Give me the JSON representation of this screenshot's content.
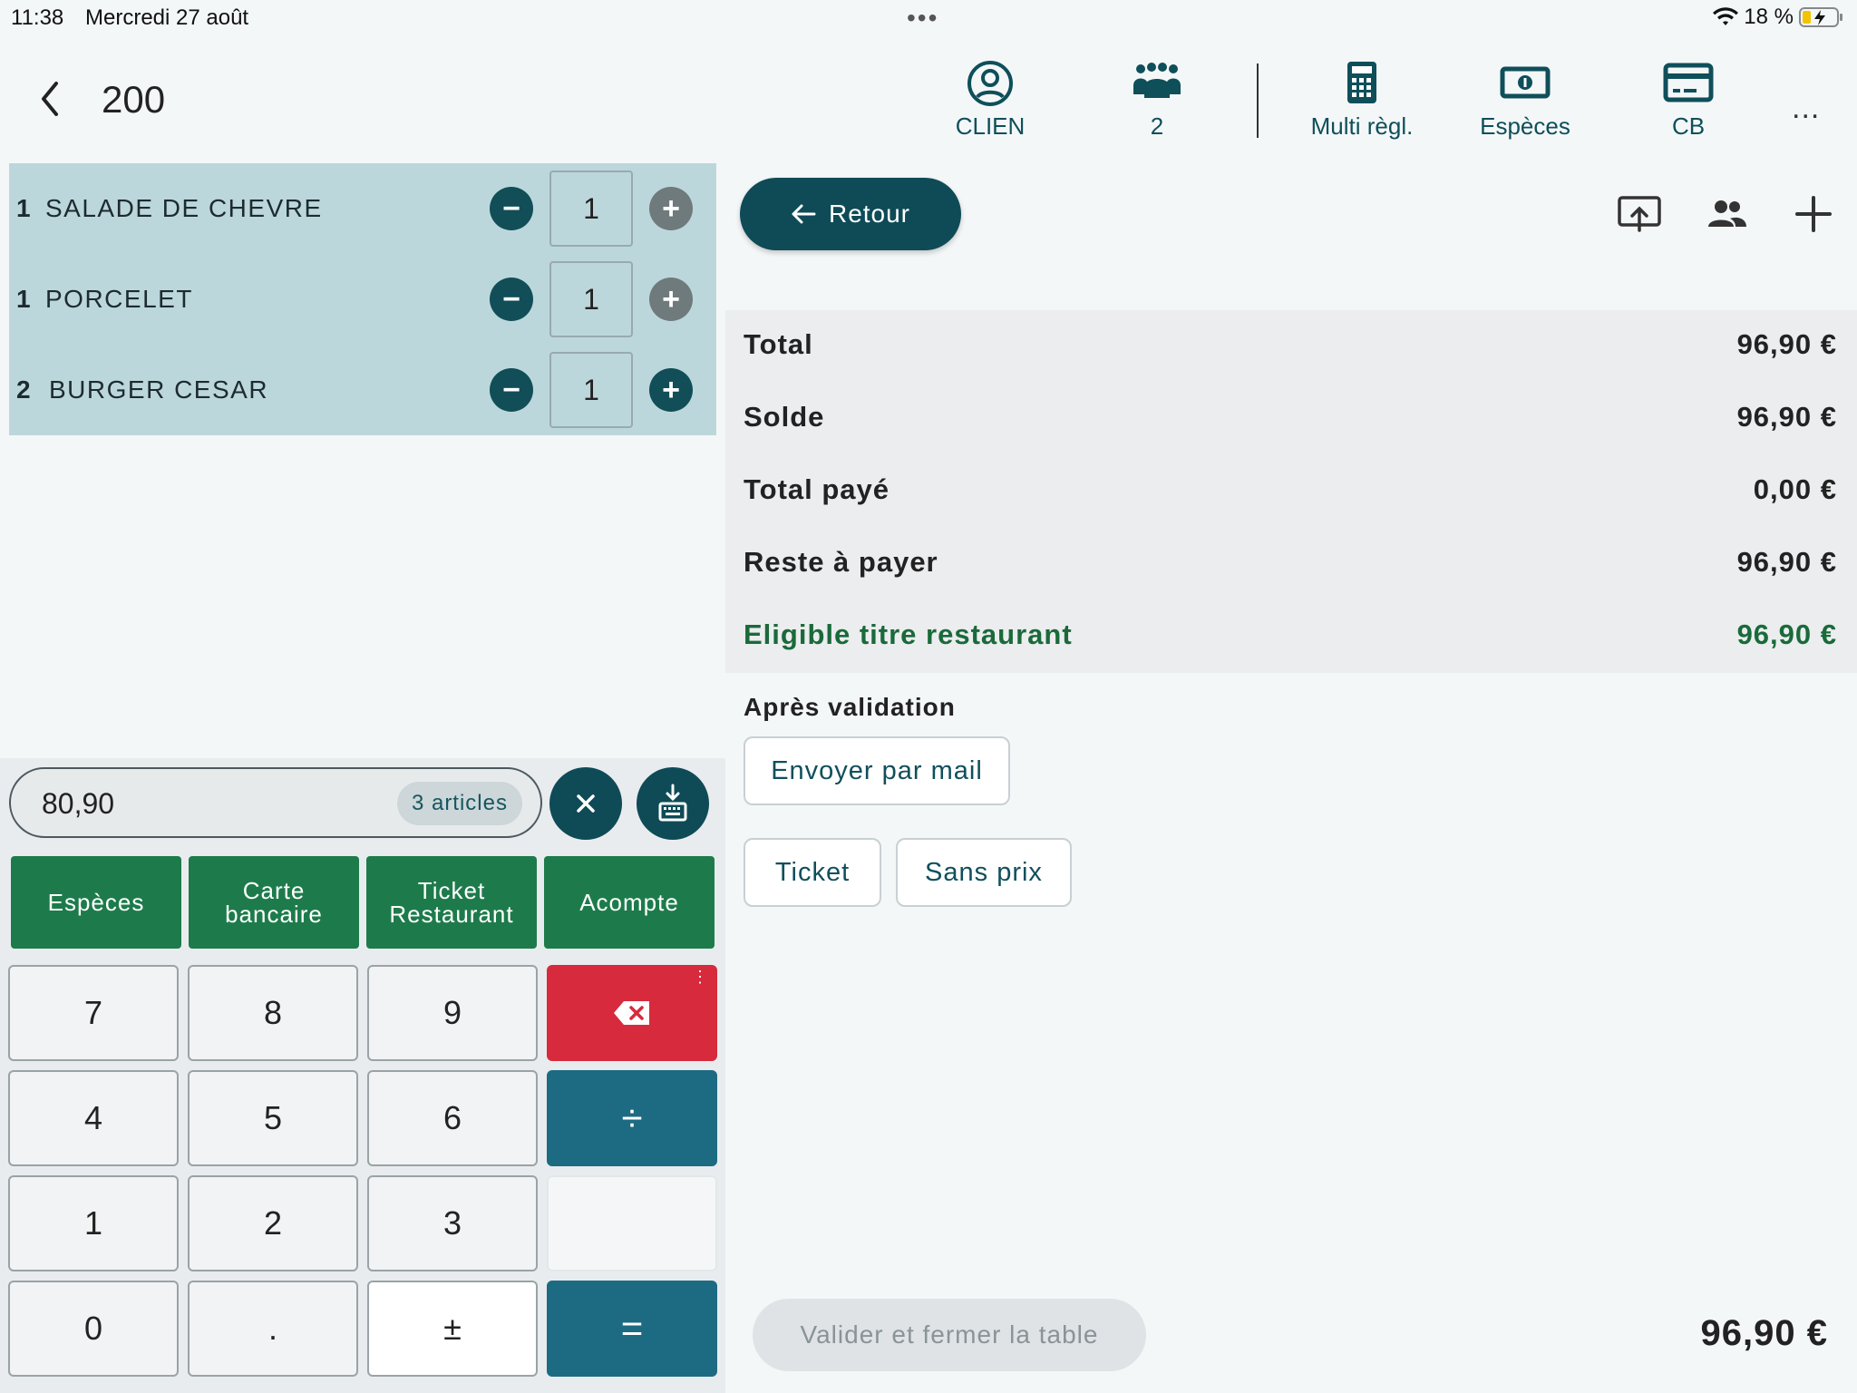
{
  "status_bar": {
    "time": "11:38",
    "date": "Mercredi 27 août",
    "battery": "18 %"
  },
  "header": {
    "table_number": "200",
    "actions": [
      {
        "label": "CLIEN",
        "icon": "user-circle-icon"
      },
      {
        "label": "2",
        "icon": "people-group-icon"
      },
      {
        "label": "Multi règl.",
        "icon": "calculator-icon"
      },
      {
        "label": "Espèces",
        "icon": "cash-icon"
      },
      {
        "label": "CB",
        "icon": "credit-card-icon"
      }
    ],
    "more": "..."
  },
  "order": {
    "items": [
      {
        "qty": "1",
        "name": "SALADE DE CHEVRE",
        "count": "1"
      },
      {
        "qty": "1",
        "name": "PORCELET",
        "count": "1"
      },
      {
        "qty": "2",
        "name": "BURGER CESAR",
        "count": "1"
      }
    ]
  },
  "input": {
    "amount": "80,90",
    "articles": "3 articles"
  },
  "payment_methods": [
    "Espèces",
    "Carte bancaire",
    "Ticket Restaurant",
    "Acompte"
  ],
  "keypad": {
    "row1": [
      "7",
      "8",
      "9"
    ],
    "row2": [
      "4",
      "5",
      "6"
    ],
    "row3": [
      "1",
      "2",
      "3"
    ],
    "row4": [
      "0",
      ".",
      "±"
    ],
    "divide": "÷",
    "equals": "="
  },
  "right": {
    "retour": "Retour",
    "summary": [
      {
        "label": "Total",
        "value": "96,90 €"
      },
      {
        "label": "Solde",
        "value": "96,90 €"
      },
      {
        "label": "Total payé",
        "value": "0,00 €"
      },
      {
        "label": "Reste à payer",
        "value": "96,90 €"
      },
      {
        "label": "Eligible titre restaurant",
        "value": "96,90 €"
      }
    ],
    "after_validation": "Après validation",
    "send_mail": "Envoyer par mail",
    "ticket": "Ticket",
    "sans_prix": "Sans prix",
    "valider": "Valider et fermer la table",
    "grand_total": "96,90 €"
  },
  "colors": {
    "accent": "#0e4b57",
    "pay_green": "#1d7b4b",
    "delete_red": "#d72a3c",
    "op_teal": "#1d6b82",
    "eligible_green": "#1a6a3a"
  }
}
